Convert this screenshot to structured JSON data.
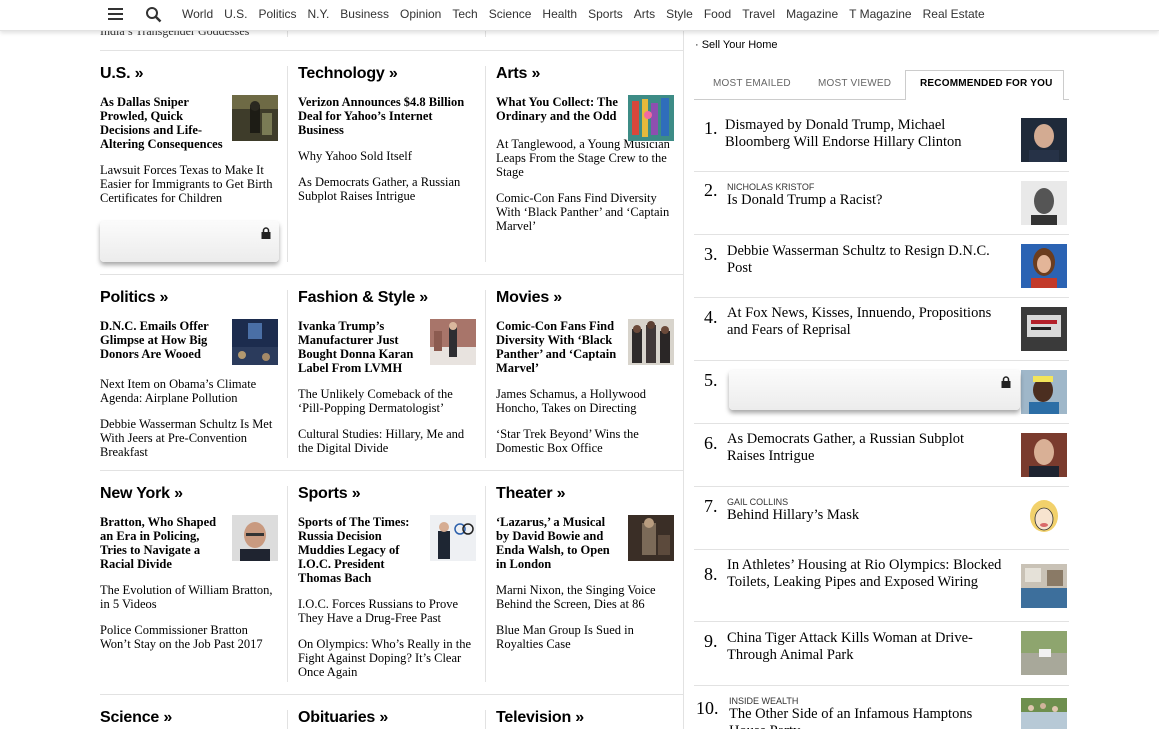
{
  "nav": {
    "links": [
      "World",
      "U.S.",
      "Politics",
      "N.Y.",
      "Business",
      "Opinion",
      "Tech",
      "Science",
      "Health",
      "Sports",
      "Arts",
      "Style",
      "Food",
      "Travel",
      "Magazine",
      "T Magazine",
      "Real Estate"
    ]
  },
  "cutoff_text": "India’s Transgender Goddesses",
  "sections": {
    "us": {
      "title": "U.S. »",
      "lead": "As Dallas Sniper Prowled, Quick Decisions and Life-Altering Consequences",
      "stories": [
        "Lawsuit Forces Texas to Make It Easier for Immigrants to Get Birth Certificates for Children"
      ]
    },
    "technology": {
      "title": "Technology »",
      "lead": "Verizon Announces $4.8 Billion Deal for Yahoo’s Internet Business",
      "stories": [
        "Why Yahoo Sold Itself",
        "As Democrats Gather, a Russian Subplot Raises Intrigue"
      ]
    },
    "arts": {
      "title": "Arts »",
      "lead": "What You Collect: The Ordinary and the Odd",
      "stories": [
        "At Tanglewood, a Young Musician Leaps From the Stage Crew to the Stage",
        "Comic-Con Fans Find Diversity With ‘Black Panther’ and ‘Captain Marvel’"
      ]
    },
    "politics": {
      "title": "Politics »",
      "lead": "D.N.C. Emails Offer Glimpse at How Big Donors Are Wooed",
      "stories": [
        "Next Item on Obama’s Climate Agenda: Airplane Pollution",
        "Debbie Wasserman Schultz Is Met With Jeers at Pre-Convention Breakfast"
      ]
    },
    "fashion": {
      "title": "Fashion & Style »",
      "lead": "Ivanka Trump’s Manufacturer Just Bought Donna Karan Label From LVMH",
      "stories": [
        "The Unlikely Comeback of the ‘Pill-Popping Dermatologist’",
        "Cultural Studies: Hillary, Me and the Digital Divide"
      ]
    },
    "movies": {
      "title": "Movies »",
      "lead": "Comic-Con Fans Find Diversity With ‘Black Panther’ and ‘Captain Marvel’",
      "stories": [
        "James Schamus, a Hollywood Honcho, Takes on Directing",
        "‘Star Trek Beyond’ Wins the Domestic Box Office"
      ]
    },
    "newyork": {
      "title": "New York »",
      "lead": "Bratton, Who Shaped an Era in Policing, Tries to Navigate a Racial Divide",
      "stories": [
        "The Evolution of William Bratton, in 5 Videos",
        "Police Commissioner Bratton Won’t Stay on the Job Past 2017"
      ]
    },
    "sports": {
      "title": "Sports »",
      "lead": "Sports of The Times: Russia Decision Muddies Legacy of I.O.C. President Thomas Bach",
      "stories": [
        "I.O.C. Forces Russians to Prove They Have a Drug-Free Past",
        "On Olympics: Who’s Really in the Fight Against Doping? It’s Clear Once Again"
      ]
    },
    "theater": {
      "title": "Theater »",
      "lead": "‘Lazarus,’ a Musical by David Bowie and Enda Walsh, to Open in London",
      "stories": [
        "Marni Nixon, the Singing Voice Behind the Screen, Dies at 86",
        "Blue Man Group Is Sued in Royalties Case"
      ]
    },
    "science": {
      "title": "Science »"
    },
    "obituaries": {
      "title": "Obituaries »"
    },
    "television": {
      "title": "Television »"
    }
  },
  "right": {
    "sell_link": "· Sell Your Home",
    "tabs": [
      "MOST EMAILED",
      "MOST VIEWED",
      "RECOMMENDED FOR YOU"
    ],
    "items": [
      {
        "num": "1.",
        "kicker": "",
        "title": "Dismayed by Donald Trump, Michael Bloomberg Will Endorse Hillary Clinton"
      },
      {
        "num": "2.",
        "kicker": "NICHOLAS KRISTOF",
        "title": "Is Donald Trump a Racist?"
      },
      {
        "num": "3.",
        "kicker": "",
        "title": "Debbie Wasserman Schultz to Resign D.N.C. Post"
      },
      {
        "num": "4.",
        "kicker": "",
        "title": "At Fox News, Kisses, Innuendo, Propositions and Fears of Reprisal"
      },
      {
        "num": "5.",
        "kicker": "",
        "title": ""
      },
      {
        "num": "6.",
        "kicker": "",
        "title": "As Democrats Gather, a Russian Subplot Raises Intrigue"
      },
      {
        "num": "7.",
        "kicker": "GAIL COLLINS",
        "title": "Behind Hillary’s Mask"
      },
      {
        "num": "8.",
        "kicker": "",
        "title": "In Athletes’ Housing at Rio Olympics: Blocked Toilets, Leaking Pipes and Exposed Wiring"
      },
      {
        "num": "9.",
        "kicker": "",
        "title": "China Tiger Attack Kills Woman at Drive-Through Animal Park"
      },
      {
        "num": "10.",
        "kicker": "INSIDE WEALTH",
        "title": "The Other Side of an Infamous Hamptons House Party"
      }
    ]
  }
}
